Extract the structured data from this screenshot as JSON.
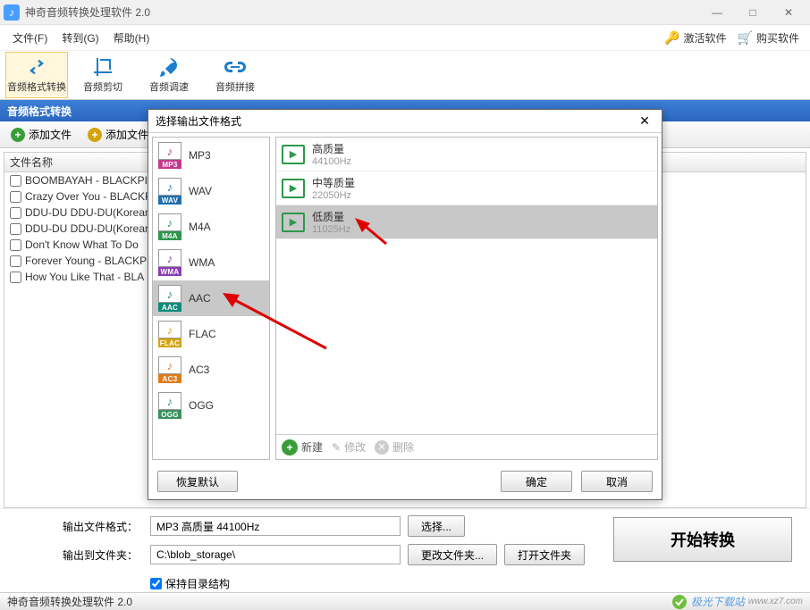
{
  "titlebar": {
    "title": "神奇音频转换处理软件 2.0"
  },
  "menubar": {
    "file": "文件(F)",
    "goto": "转到(G)",
    "help": "帮助(H)",
    "activate": "激活软件",
    "buy": "购买软件"
  },
  "toolbar": {
    "items": [
      {
        "label": "音频格式转换"
      },
      {
        "label": "音频剪切"
      },
      {
        "label": "音频调速"
      },
      {
        "label": "音频拼接"
      }
    ]
  },
  "section": {
    "title": "音频格式转换"
  },
  "subtoolbar": {
    "add_file": "添加文件",
    "add_folder": "添加文件"
  },
  "filelist": {
    "header": "文件名称",
    "rows": [
      "BOOMBAYAH - BLACKPIN",
      "Crazy Over You - BLACKP",
      "DDU-DU DDU-DU(Korean",
      "DDU-DU DDU-DU(Korean",
      "Don't Know What To Do",
      "Forever Young - BLACKP",
      "How You Like That - BLA"
    ]
  },
  "bottom": {
    "output_format_label": "输出文件格式：",
    "output_format_value": "MP3 高质量 44100Hz",
    "select_btn": "选择...",
    "output_folder_label": "输出到文件夹：",
    "output_folder_value": "C:\\blob_storage\\",
    "change_folder_btn": "更改文件夹...",
    "open_folder_btn": "打开文件夹",
    "preserve_dir": "保持目录结构",
    "start": "开始转换"
  },
  "statusbar": {
    "text": "神奇音频转换处理软件 2.0",
    "brand": "极光下载站",
    "brand_url": "www.xz7.com"
  },
  "dialog": {
    "title": "选择输出文件格式",
    "formats": [
      {
        "code": "MP3",
        "label": "MP3",
        "color": "#c33a8c"
      },
      {
        "code": "WAV",
        "label": "WAV",
        "color": "#1f6fb0"
      },
      {
        "code": "M4A",
        "label": "M4A",
        "color": "#2e974c"
      },
      {
        "code": "WMA",
        "label": "WMA",
        "color": "#8a3db5"
      },
      {
        "code": "AAC",
        "label": "AAC",
        "color": "#0e8a7a"
      },
      {
        "code": "FLAC",
        "label": "FLAC",
        "color": "#d4a40f"
      },
      {
        "code": "AC3",
        "label": "AC3",
        "color": "#e07b1a"
      },
      {
        "code": "OGG",
        "label": "OGG",
        "color": "#3a915e"
      }
    ],
    "qualities": [
      {
        "name": "高质量",
        "hz": "44100Hz"
      },
      {
        "name": "中等质量",
        "hz": "22050Hz"
      },
      {
        "name": "低质量",
        "hz": "11025Hz"
      }
    ],
    "actions": {
      "new": "新建",
      "edit": "修改",
      "delete": "删除"
    },
    "footer": {
      "restore": "恢复默认",
      "ok": "确定",
      "cancel": "取消"
    }
  }
}
